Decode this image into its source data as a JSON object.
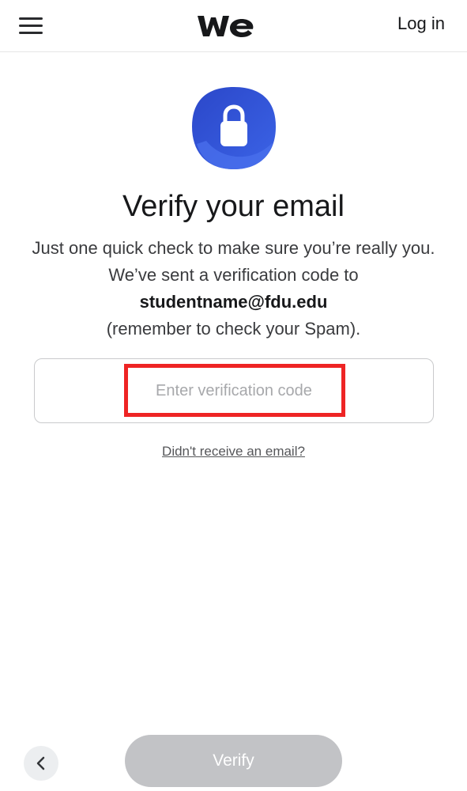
{
  "header": {
    "menu_icon": "hamburger-menu-icon",
    "logo_icon": "wetransfer-we-logo",
    "login_label": "Log in"
  },
  "main": {
    "lock_icon": "padlock-icon",
    "title": "Verify your email",
    "description_line1": "Just one quick check to make sure you’re really you. We’ve sent a verification code to",
    "email": "studentname@fdu.edu",
    "description_line2": "(remember to check your Spam).",
    "code_input": {
      "value": "",
      "placeholder": "Enter verification code"
    },
    "resend_link": "Didn't receive an email?"
  },
  "footer": {
    "back_icon": "chevron-left-icon",
    "verify_label": "Verify"
  },
  "colors": {
    "brand_blue": "#2f55d4",
    "highlight_red": "#ee2424",
    "verify_disabled": "#c2c3c6"
  }
}
